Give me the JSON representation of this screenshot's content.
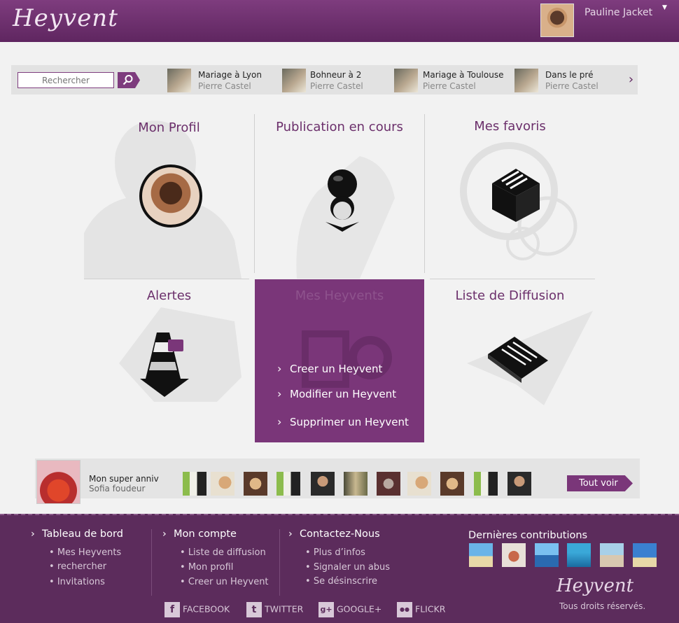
{
  "header": {
    "logo_text": "Heyvent",
    "user_name": "Pauline Jacket",
    "user_caret": "▼"
  },
  "search": {
    "placeholder": "Rechercher",
    "button_icon": "search-icon"
  },
  "stories": [
    {
      "title": "Mariage à Lyon",
      "author": "Pierre Castel"
    },
    {
      "title": "Bohneur à 2",
      "author": "Pierre Castel"
    },
    {
      "title": "Mariage à Toulouse",
      "author": "Pierre Castel"
    },
    {
      "title": "Dans le pré",
      "author": "Pierre Castel"
    }
  ],
  "strip_next": "›",
  "tiles": {
    "profile": "Mon Profil",
    "publication": "Publication en cours",
    "favorites": "Mes favoris",
    "alerts": "Alertes",
    "heyvents": "Mes Heyvents",
    "diffusion": "Liste de Diffusion"
  },
  "heyvents_menu": {
    "chevron": "›",
    "create": "Creer un Heyvent",
    "edit": "Modifier un Heyvent",
    "delete": "Supprimer un Heyvent"
  },
  "event": {
    "title": "Mon super anniv",
    "author": "Sofia foudeur",
    "see_all": "Tout voir"
  },
  "footer": {
    "chevron": "›",
    "col1": {
      "title": "Tableau de bord",
      "items": [
        "Mes Heyvents",
        "rechercher",
        "Invitations"
      ]
    },
    "col2": {
      "title": "Mon compte",
      "items": [
        "Liste de diffusion",
        "Mon profil",
        "Creer un Heyvent"
      ]
    },
    "col3": {
      "title": "Contactez-Nous",
      "items": [
        "Plus d’infos",
        "Signaler un abus",
        "Se désinscrire"
      ]
    },
    "contrib_title": "Dernières contributions",
    "social": {
      "facebook": "FACEBOOK",
      "facebook_icon": "f",
      "twitter": "TWITTER",
      "twitter_icon": "t",
      "google": "GOOGLE+",
      "google_icon": "g+",
      "flickr": "FLICKR",
      "flickr_icon": "●●"
    },
    "logo_text": "Heyvent",
    "rights": "Tous droits réservés.",
    "bullet": "•"
  },
  "colors": {
    "brand": "#7a3679",
    "brand_dark": "#5c2c5c",
    "background": "#f2f2f2"
  }
}
